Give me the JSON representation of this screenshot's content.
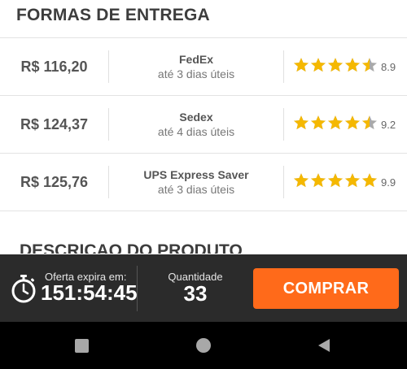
{
  "section": {
    "title": "FORMAS DE ENTREGA"
  },
  "shipping_options": [
    {
      "price": "R$ 116,20",
      "carrier": "FedEx",
      "eta": "até 3 dias úteis",
      "rating": 4.5,
      "score": "8.9"
    },
    {
      "price": "R$ 124,37",
      "carrier": "Sedex",
      "eta": "até 4 dias úteis",
      "rating": 4.5,
      "score": "9.2"
    },
    {
      "price": "R$ 125,76",
      "carrier": "UPS Express Saver",
      "eta": "até 3 dias úteis",
      "rating": 5,
      "score": "9.9"
    }
  ],
  "next_section": {
    "title": "DESCRIÇÃO DO PRODUTO"
  },
  "offer": {
    "label": "Oferta expira em:",
    "time": "151:54:45"
  },
  "quantity": {
    "label": "Quantidade",
    "value": "33"
  },
  "buy_button": {
    "label": "COMPRAR"
  },
  "colors": {
    "accent": "#ff6a1a",
    "star": "#f5b800",
    "star_empty": "#a9a9a9",
    "bar": "#2b2b2b"
  },
  "icons": {
    "timer": "stopwatch-icon",
    "nav_recent": "square-icon",
    "nav_home": "circle-icon",
    "nav_back": "triangle-back-icon"
  }
}
